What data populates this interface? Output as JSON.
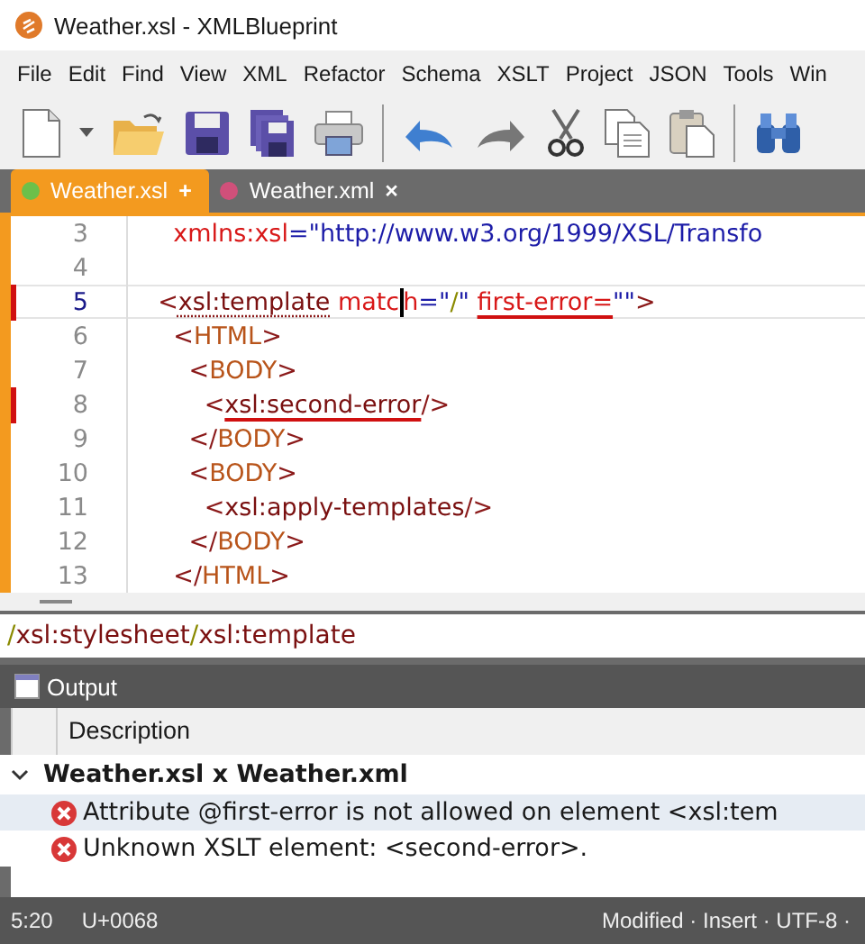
{
  "window": {
    "title": "Weather.xsl - XMLBlueprint"
  },
  "menu": [
    "File",
    "Edit",
    "Find",
    "View",
    "XML",
    "Refactor",
    "Schema",
    "XSLT",
    "Project",
    "JSON",
    "Tools",
    "Win"
  ],
  "tabs": [
    {
      "label": "Weather.xsl",
      "marker": "+",
      "color": "#6cc04a",
      "selected": true
    },
    {
      "label": "Weather.xml",
      "marker": "×",
      "color": "#d0507a",
      "selected": false
    }
  ],
  "editor": {
    "lines": [
      {
        "number": "3",
        "error": false,
        "current": false,
        "tokens": [
          {
            "text": "    xmlns:xsl",
            "kind": "attr"
          },
          {
            "text": "=\"http://www.w3.org/1999/XSL/Transfo",
            "kind": "value"
          }
        ]
      },
      {
        "number": "4",
        "error": false,
        "current": false
      },
      {
        "number": "5",
        "error": true,
        "current": true,
        "tokens": [
          {
            "text": "  <",
            "kind": "bracket"
          },
          {
            "text": "xsl:template",
            "kind": "xsl",
            "warning": true
          },
          {
            "text": " matc",
            "kind": "attr"
          },
          {
            "text": "h",
            "kind": "attr",
            "caret": true
          },
          {
            "text": "=\"",
            "kind": "value"
          },
          {
            "text": "/",
            "kind": "path"
          },
          {
            "text": "\" ",
            "kind": "value"
          },
          {
            "text": "first-error=",
            "kind": "attr",
            "error": true
          },
          {
            "text": "\"\"",
            "kind": "value"
          },
          {
            "text": ">",
            "kind": "bracket"
          }
        ]
      },
      {
        "number": "6",
        "error": false,
        "current": false,
        "tokens": [
          {
            "text": "    <",
            "kind": "bracket"
          },
          {
            "text": "HTML",
            "kind": "html"
          },
          {
            "text": ">",
            "kind": "bracket"
          }
        ]
      },
      {
        "number": "7",
        "error": false,
        "current": false,
        "tokens": [
          {
            "text": "      <",
            "kind": "bracket"
          },
          {
            "text": "BODY",
            "kind": "html"
          },
          {
            "text": ">",
            "kind": "bracket"
          }
        ]
      },
      {
        "number": "8",
        "error": true,
        "current": false,
        "tokens": [
          {
            "text": "        <",
            "kind": "bracket"
          },
          {
            "text": "xsl:second-error",
            "kind": "xsl",
            "error": true
          },
          {
            "text": "/>",
            "kind": "bracket"
          }
        ]
      },
      {
        "number": "9",
        "error": false,
        "current": false,
        "tokens": [
          {
            "text": "      </",
            "kind": "bracket"
          },
          {
            "text": "BODY",
            "kind": "html"
          },
          {
            "text": ">",
            "kind": "bracket"
          }
        ]
      },
      {
        "number": "10",
        "error": false,
        "current": false,
        "tokens": [
          {
            "text": "      <",
            "kind": "bracket"
          },
          {
            "text": "BODY",
            "kind": "html"
          },
          {
            "text": ">",
            "kind": "bracket"
          }
        ]
      },
      {
        "number": "11",
        "error": false,
        "current": false,
        "tokens": [
          {
            "text": "        <",
            "kind": "bracket"
          },
          {
            "text": "xsl:apply-templates",
            "kind": "xsl"
          },
          {
            "text": "/>",
            "kind": "bracket"
          }
        ]
      },
      {
        "number": "12",
        "error": false,
        "current": false,
        "tokens": [
          {
            "text": "      </",
            "kind": "bracket"
          },
          {
            "text": "BODY",
            "kind": "html"
          },
          {
            "text": ">",
            "kind": "bracket"
          }
        ]
      },
      {
        "number": "13",
        "error": false,
        "current": false,
        "tokens": [
          {
            "text": "    </",
            "kind": "bracket"
          },
          {
            "text": "HTML",
            "kind": "html"
          },
          {
            "text": ">",
            "kind": "bracket"
          }
        ]
      }
    ]
  },
  "breadcrumb": [
    {
      "text": "/",
      "kind": "path"
    },
    {
      "text": "xsl:stylesheet",
      "kind": "xsl"
    },
    {
      "text": "/",
      "kind": "path"
    },
    {
      "text": "xsl:template",
      "kind": "xsl"
    }
  ],
  "output": {
    "title": "Output",
    "columns": [
      "Description"
    ],
    "groups": [
      {
        "label": "Weather.xsl x Weather.xml",
        "expanded": true,
        "items": [
          {
            "text": "Attribute @first-error is not allowed on element <xsl:tem",
            "selected": true
          },
          {
            "text": "Unknown XSLT element: <second-error>.",
            "selected": false
          }
        ]
      }
    ]
  },
  "status_bar": {
    "position": "5:20",
    "char_code": "U+0068",
    "state": "Modified · Insert · UTF-8 ·"
  }
}
